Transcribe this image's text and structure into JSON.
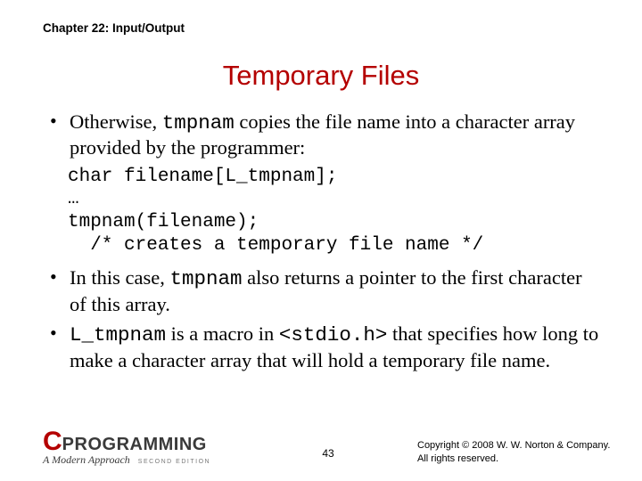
{
  "chapter": "Chapter 22: Input/Output",
  "title": "Temporary Files",
  "bullets": {
    "b1_pre": "Otherwise, ",
    "b1_code": "tmpnam",
    "b1_post": " copies the file name into a character array provided by the programmer:",
    "code": "char filename[L_tmpnam];\n…\ntmpnam(filename);\n  /* creates a temporary file name */",
    "b2_pre": "In this case, ",
    "b2_code": "tmpnam",
    "b2_post": " also returns a pointer to the first character of this array.",
    "b3_code1": "L_tmpnam",
    "b3_mid": " is a macro in ",
    "b3_code2": "<stdio.h>",
    "b3_post": " that specifies how long to make a character array that will hold a temporary file name."
  },
  "footer": {
    "logo_c": "C",
    "logo_prog": "PROGRAMMING",
    "logo_sub": "A Modern Approach",
    "logo_ed": "SECOND EDITION",
    "page": "43",
    "copyright": "Copyright © 2008 W. W. Norton & Company.\nAll rights reserved."
  }
}
